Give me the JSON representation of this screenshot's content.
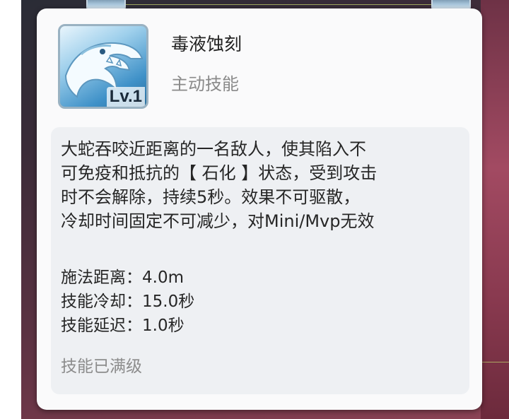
{
  "skill": {
    "name": "毒液蚀刻",
    "type": "主动技能",
    "level_badge": "Lv.1",
    "icon": "serpent-head-icon"
  },
  "description": "大蛇吞咬近距离的一名敌人，使其陷入不\n可免疫和抵抗的【 石化 】状态，受到攻击\n时不会解除，持续5秒。效果不可驱散，\n冷却时间固定不可减少，对Mini/Mvp无效",
  "stats": [
    {
      "label": "施法距离：",
      "value": "4.0m"
    },
    {
      "label": "技能冷却：",
      "value": "15.0秒"
    },
    {
      "label": "技能延迟：",
      "value": "1.0秒"
    }
  ],
  "max_level_text": "技能已满级",
  "colors": {
    "panel": "#fafafb",
    "info_box": "#eef0f3",
    "text_primary": "#262626",
    "text_secondary": "#8a8a8a",
    "icon_blue": "#3f91c8"
  }
}
